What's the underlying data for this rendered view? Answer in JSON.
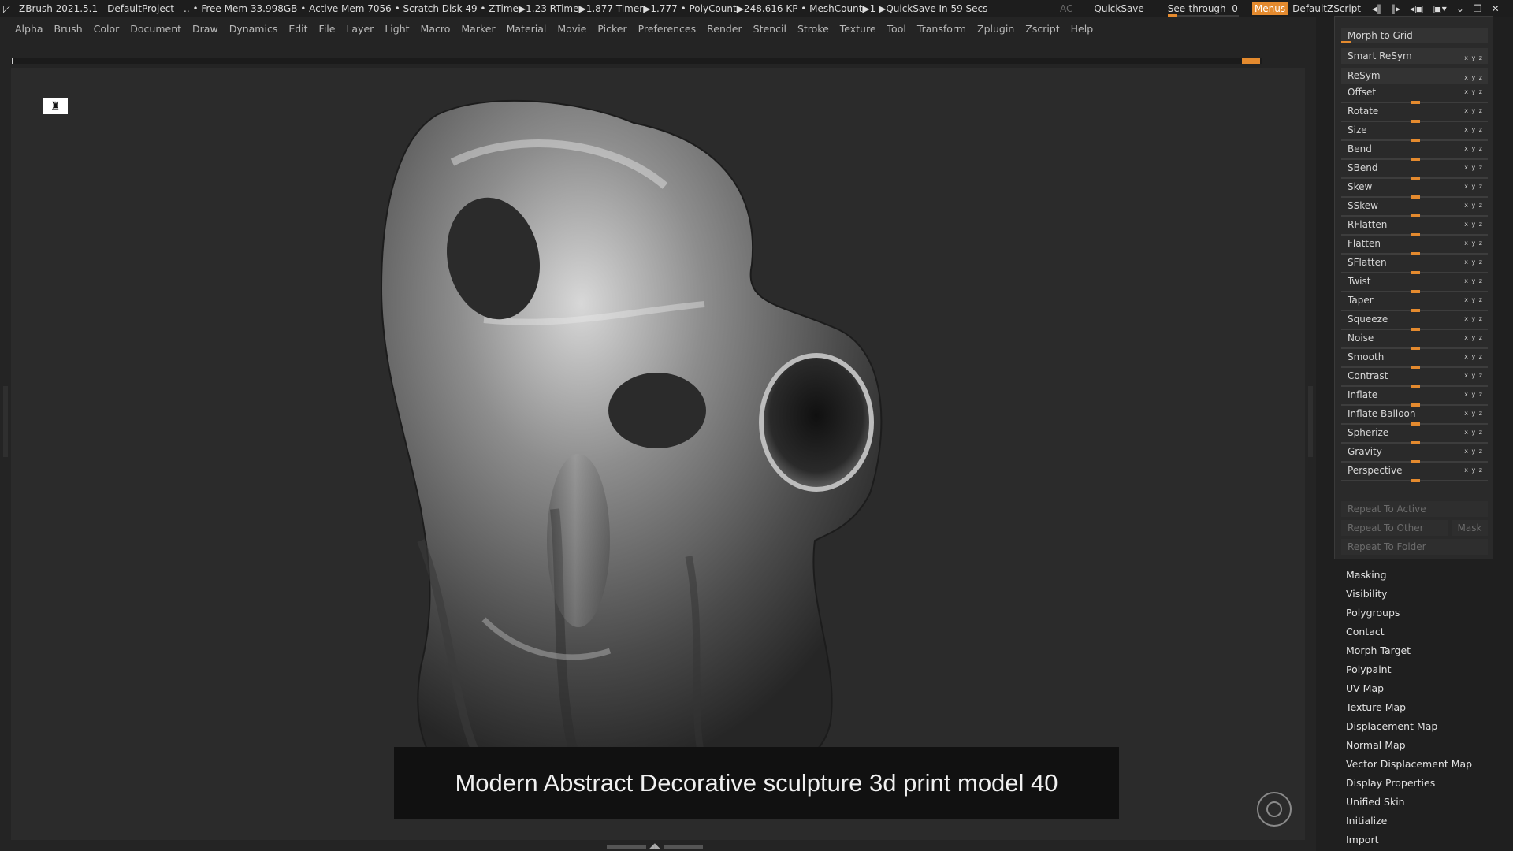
{
  "titlebar": {
    "app": "ZBrush 2021.5.1",
    "project": "DefaultProject",
    "stats": "..  • Free Mem 33.998GB • Active Mem 7056 • Scratch Disk 49 •  ZTime▶1.23 RTime▶1.877 Timer▶1.777 • PolyCount▶248.616 KP  • MeshCount▶1  ▶QuickSave In 59 Secs",
    "ac": "AC",
    "quicksave": "QuickSave",
    "seethrough": "See-through",
    "seethrough_value": "0",
    "menus": "Menus",
    "default_zscript": "DefaultZScript"
  },
  "menu": [
    "Alpha",
    "Brush",
    "Color",
    "Document",
    "Draw",
    "Dynamics",
    "Edit",
    "File",
    "Layer",
    "Light",
    "Macro",
    "Marker",
    "Material",
    "Movie",
    "Picker",
    "Preferences",
    "Render",
    "Stencil",
    "Stroke",
    "Texture",
    "Tool",
    "Transform",
    "Zplugin",
    "Zscript",
    "Help"
  ],
  "caption": "Modern Abstract Decorative sculpture 3d print model 40",
  "deformation": {
    "morph_to_grid": "Morph to Grid",
    "smart_resym": "Smart ReSym",
    "resym": "ReSym",
    "sliders": [
      "Offset",
      "Rotate",
      "Size",
      "Bend",
      "SBend",
      "Skew",
      "SSkew",
      "RFlatten",
      "Flatten",
      "SFlatten",
      "Twist",
      "Taper",
      "Squeeze",
      "Noise",
      "Smooth",
      "Contrast",
      "Inflate",
      "Inflate Balloon",
      "Spherize",
      "Gravity",
      "Perspective"
    ],
    "repeat_to_active": "Repeat To Active",
    "repeat_to_other": "Repeat To Other",
    "mask": "Mask",
    "repeat_to_folder": "Repeat To Folder"
  },
  "subpalettes": [
    "Masking",
    "Visibility",
    "Polygroups",
    "Contact",
    "Morph Target",
    "Polypaint",
    "UV Map",
    "Texture Map",
    "Displacement Map",
    "Normal Map",
    "Vector Displacement Map",
    "Display Properties",
    "Unified Skin",
    "Initialize",
    "Import"
  ],
  "colors": {
    "accent": "#e48a2e",
    "background": "#242424",
    "panel": "#2a2a2a"
  }
}
